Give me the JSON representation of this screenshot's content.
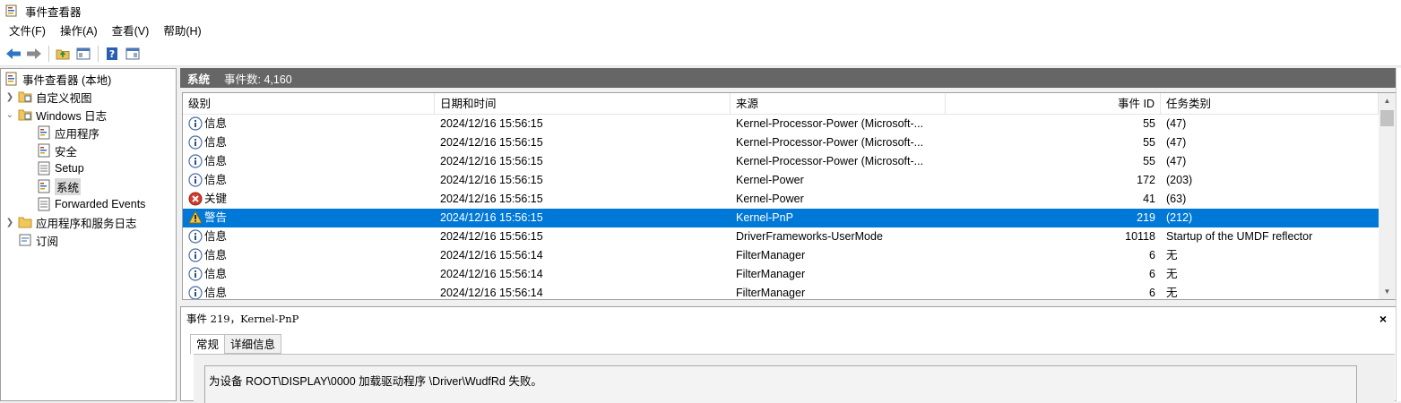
{
  "window": {
    "title": "事件查看器"
  },
  "menu": [
    "文件(F)",
    "操作(A)",
    "查看(V)",
    "帮助(H)"
  ],
  "tree": {
    "root": "事件查看器 (本地)",
    "custom_views": "自定义视图",
    "windows_logs": "Windows 日志",
    "application": "应用程序",
    "security": "安全",
    "setup": "Setup",
    "system": "系统",
    "forwarded": "Forwarded Events",
    "apps_services": "应用程序和服务日志",
    "subscriptions": "订阅"
  },
  "header": {
    "name": "系统",
    "count": "事件数: 4,160"
  },
  "columns": {
    "level": "级别",
    "datetime": "日期和时间",
    "source": "来源",
    "event_id": "事件 ID",
    "category": "任务类别"
  },
  "events": [
    {
      "level": "信息",
      "icon": "info",
      "datetime": "2024/12/16 15:56:15",
      "source": "Kernel-Processor-Power (Microsoft-...",
      "event_id": "55",
      "category": "(47)"
    },
    {
      "level": "信息",
      "icon": "info",
      "datetime": "2024/12/16 15:56:15",
      "source": "Kernel-Processor-Power (Microsoft-...",
      "event_id": "55",
      "category": "(47)"
    },
    {
      "level": "信息",
      "icon": "info",
      "datetime": "2024/12/16 15:56:15",
      "source": "Kernel-Processor-Power (Microsoft-...",
      "event_id": "55",
      "category": "(47)"
    },
    {
      "level": "信息",
      "icon": "info",
      "datetime": "2024/12/16 15:56:15",
      "source": "Kernel-Power",
      "event_id": "172",
      "category": "(203)"
    },
    {
      "level": "关键",
      "icon": "critical",
      "datetime": "2024/12/16 15:56:15",
      "source": "Kernel-Power",
      "event_id": "41",
      "category": "(63)"
    },
    {
      "level": "警告",
      "icon": "warning",
      "datetime": "2024/12/16 15:56:15",
      "source": "Kernel-PnP",
      "event_id": "219",
      "category": "(212)",
      "selected": true
    },
    {
      "level": "信息",
      "icon": "info",
      "datetime": "2024/12/16 15:56:15",
      "source": "DriverFrameworks-UserMode",
      "event_id": "10118",
      "category": "Startup of the UMDF reflector"
    },
    {
      "level": "信息",
      "icon": "info",
      "datetime": "2024/12/16 15:56:14",
      "source": "FilterManager",
      "event_id": "6",
      "category": "无"
    },
    {
      "level": "信息",
      "icon": "info",
      "datetime": "2024/12/16 15:56:14",
      "source": "FilterManager",
      "event_id": "6",
      "category": "无"
    },
    {
      "level": "信息",
      "icon": "info",
      "datetime": "2024/12/16 15:56:14",
      "source": "FilterManager",
      "event_id": "6",
      "category": "无"
    }
  ],
  "detail": {
    "title": "事件 219，Kernel-PnP",
    "close": "×",
    "tabs": [
      "常规",
      "详细信息"
    ],
    "message": "为设备 ROOT\\DISPLAY\\0000 加载驱动程序 \\Driver\\WudfRd 失败。"
  },
  "colors": {
    "selection": "#0078d7",
    "header_bar": "#666666"
  }
}
